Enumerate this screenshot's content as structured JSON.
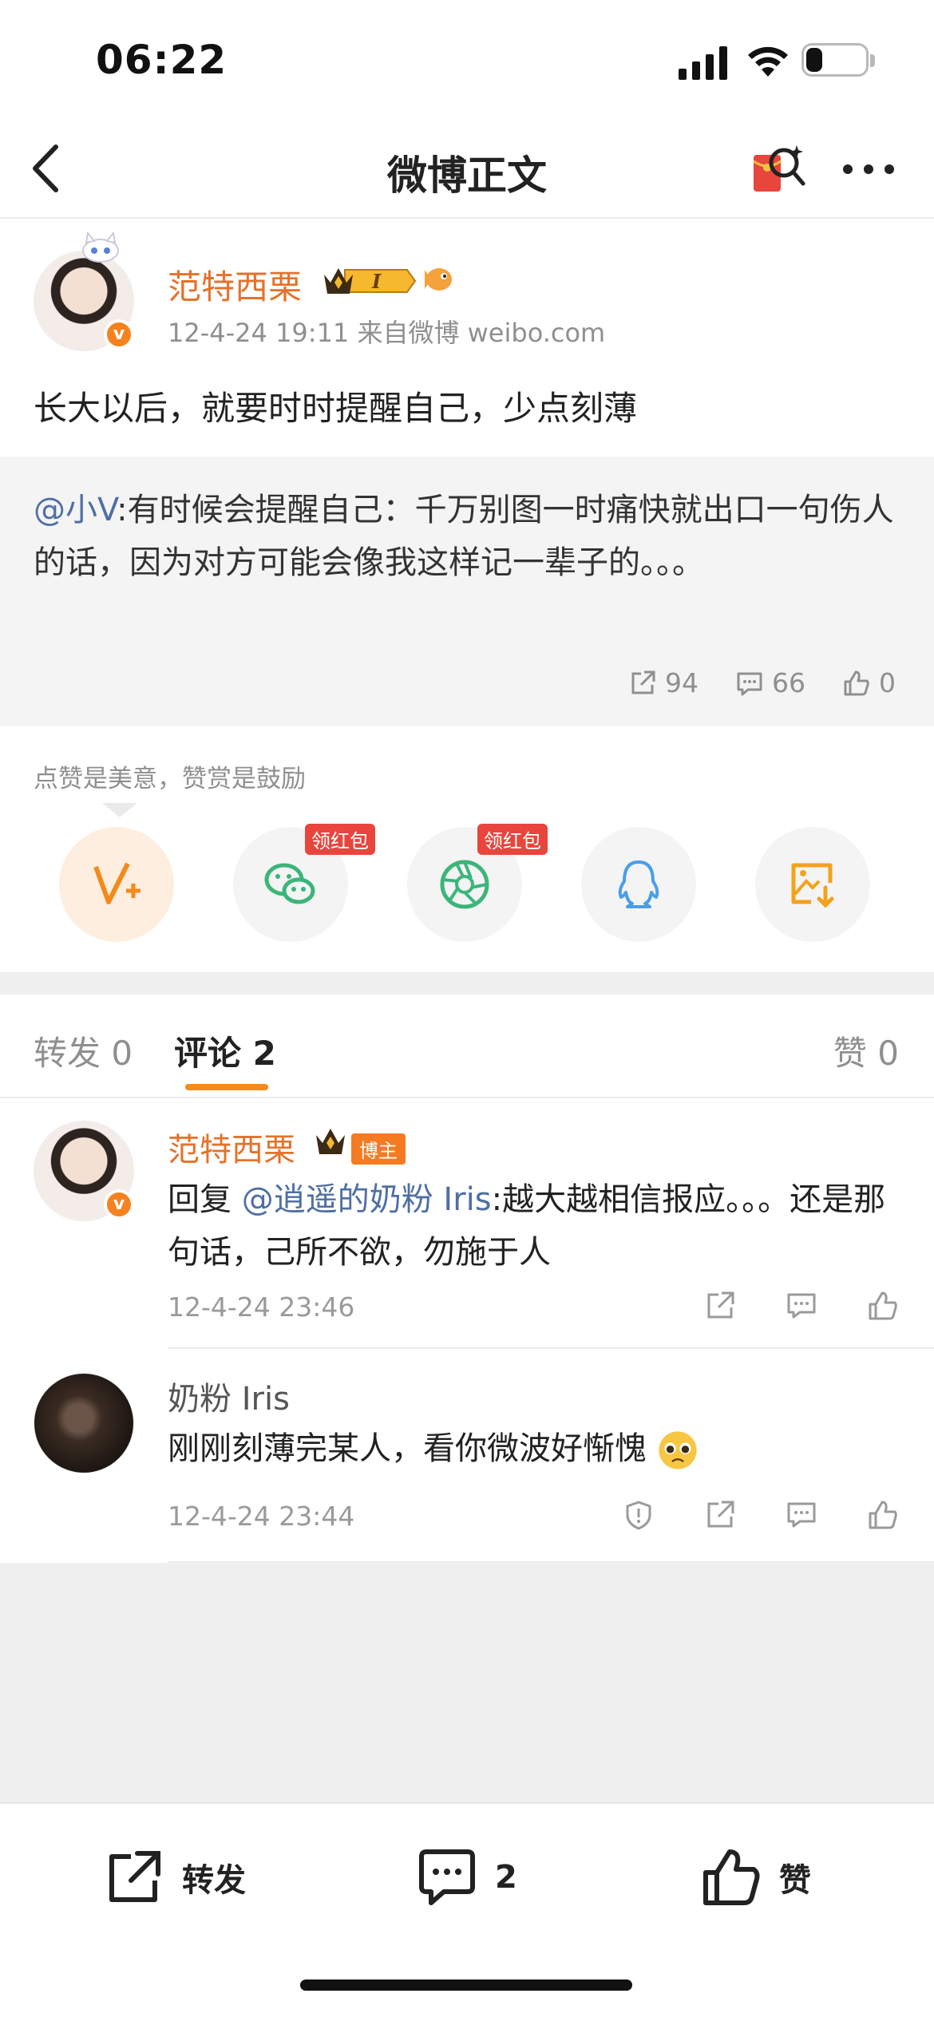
{
  "status_bar": {
    "time": "06:22",
    "battery": "26"
  },
  "nav": {
    "title": "微博正文"
  },
  "post": {
    "author": "范特西栗",
    "meta": "12-4-24 19:11  来自微博 weibo.com",
    "text": "长大以后，就要时时提醒自己，少点刻薄",
    "retweet": {
      "mention": "@小V",
      "text": ":有时候会提醒自己：千万别图一时痛快就出口一句伤人的话，因为对方可能会像我这样记一辈子的。。。",
      "reposts": "94",
      "comments": "66",
      "likes": "0"
    }
  },
  "share": {
    "hint": "点赞是美意，赞赏是鼓励",
    "tag_label": "领红包",
    "buttons": [
      "v-plus-icon",
      "wechat-icon",
      "moments-icon",
      "qq-icon",
      "save-image-icon"
    ]
  },
  "tabs": {
    "repost": "转发 0",
    "comment": "评论 2",
    "like": "赞 0"
  },
  "comments": [
    {
      "author": "范特西栗",
      "badge": "博主",
      "prefix": "回复 ",
      "mention": "@逍遥的奶粉 Iris",
      "text": ":越大越相信报应。。。还是那句话，己所不欲，勿施于人",
      "time": "12-4-24 23:46"
    },
    {
      "author": "奶粉 Iris",
      "text": "刚刚刻薄完某人，看你微波好惭愧",
      "time": "12-4-24 23:44"
    }
  ],
  "toolbar": {
    "repost": "转发",
    "comment": "2",
    "like": "赞"
  },
  "colors": {
    "accent": "#f38a1c",
    "username": "#e4722a",
    "mention": "#4f6fa3",
    "red_tag": "#e8453c"
  }
}
